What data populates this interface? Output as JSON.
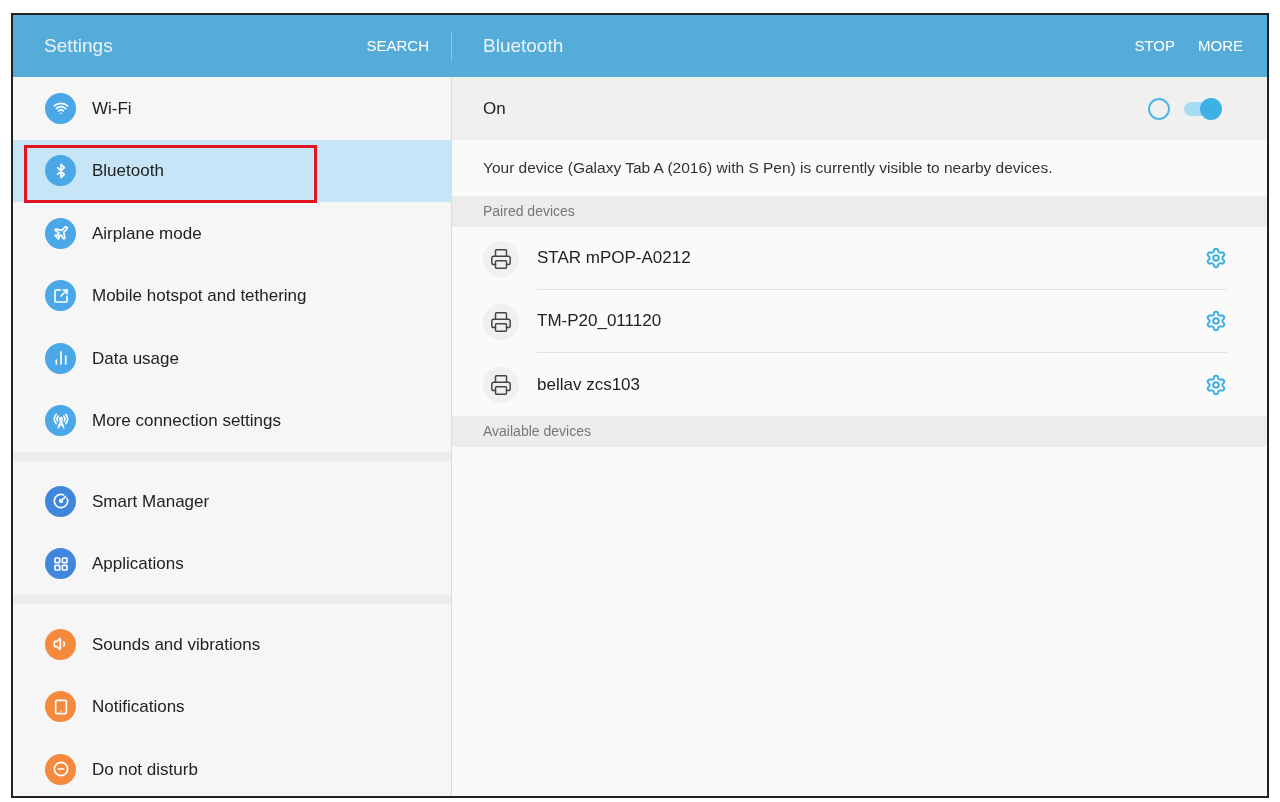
{
  "header": {
    "title": "Settings",
    "search": "SEARCH",
    "detail_title": "Bluetooth",
    "actions": [
      "STOP",
      "MORE"
    ]
  },
  "sidebar": {
    "groups": [
      {
        "items": [
          {
            "label": "Wi-Fi",
            "kind": "wifi",
            "color": "#4aa8e8",
            "selected": false
          },
          {
            "label": "Bluetooth",
            "kind": "bluetooth",
            "color": "#4aa8e8",
            "selected": true,
            "highlighted": true
          },
          {
            "label": "Airplane mode",
            "kind": "airplane",
            "color": "#4aa8e8",
            "selected": false
          },
          {
            "label": "Mobile hotspot and tethering",
            "kind": "hotspot",
            "color": "#4aa8e8",
            "selected": false
          },
          {
            "label": "Data usage",
            "kind": "data",
            "color": "#4aa8e8",
            "selected": false
          },
          {
            "label": "More connection settings",
            "kind": "antenna",
            "color": "#4aa8e8",
            "selected": false
          }
        ]
      },
      {
        "items": [
          {
            "label": "Smart Manager",
            "kind": "gauge",
            "color": "#3f86dc",
            "selected": false
          },
          {
            "label": "Applications",
            "kind": "grid",
            "color": "#3f86dc",
            "selected": false
          }
        ]
      },
      {
        "items": [
          {
            "label": "Sounds and vibrations",
            "kind": "sound",
            "color": "#f58a3d",
            "selected": false
          },
          {
            "label": "Notifications",
            "kind": "notification",
            "color": "#f58a3d",
            "selected": false
          },
          {
            "label": "Do not disturb",
            "kind": "dnd",
            "color": "#f58a3d",
            "selected": false
          }
        ]
      }
    ]
  },
  "detail": {
    "switch": {
      "label": "On",
      "on": true
    },
    "visibility_note": "Your device (Galaxy Tab A (2016) with S Pen) is currently visible to nearby devices.",
    "sections": [
      {
        "title": "Paired devices",
        "devices": [
          {
            "name": "STAR mPOP-A0212"
          },
          {
            "name": "TM-P20_011120"
          },
          {
            "name": "bellav zcs103"
          }
        ]
      },
      {
        "title": "Available devices"
      }
    ]
  }
}
